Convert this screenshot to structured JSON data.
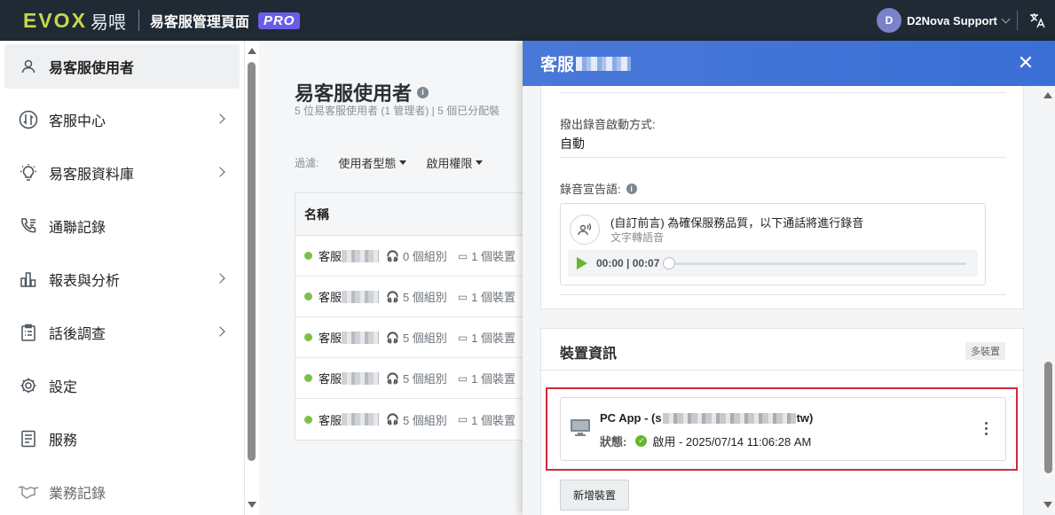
{
  "topbar": {
    "logo_text": "EVOX",
    "logo_cn": "易喂",
    "app_title": "易客服管理頁面",
    "pro_badge": "PRO",
    "user_initial": "D",
    "user_name": "D2Nova Support",
    "lang_icon": "translate-icon"
  },
  "sidebar": {
    "items": [
      {
        "label": "易客服使用者",
        "icon": "user-icon",
        "active": true
      },
      {
        "label": "客服中心",
        "icon": "phone-swap-icon"
      },
      {
        "label": "易客服資料庫",
        "icon": "bulb-icon"
      },
      {
        "label": "通聯記錄",
        "icon": "call-log-icon"
      },
      {
        "label": "報表與分析",
        "icon": "bar-chart-icon"
      },
      {
        "label": "話後調查",
        "icon": "clipboard-icon"
      },
      {
        "label": "設定",
        "icon": "gear-icon"
      },
      {
        "label": "服務",
        "icon": "document-icon"
      },
      {
        "label": "業務記錄",
        "icon": "handshake-icon"
      }
    ]
  },
  "main": {
    "title": "易客服使用者",
    "subtitle": "5 位易客服使用者 (1 管理者) | 5 個已分配裝",
    "filter_label": "過濾:",
    "filter_user_type": "使用者型態",
    "filter_permission": "啟用權限",
    "table": {
      "header_name": "名稱",
      "rows": [
        {
          "name": "客服",
          "groups": "0 個組別",
          "devices": "1 個裝置"
        },
        {
          "name": "客服",
          "groups": "5 個組別",
          "devices": "1 個裝置"
        },
        {
          "name": "客服",
          "groups": "5 個組別",
          "devices": "1 個裝置"
        },
        {
          "name": "客服",
          "groups": "5 個組別",
          "devices": "1 個裝置"
        },
        {
          "name": "客服",
          "groups": "5 個組別",
          "devices": "1 個裝置"
        }
      ]
    }
  },
  "drawer": {
    "title": "客服",
    "recording": {
      "start_label": "撥出錄音啟動方式:",
      "start_value": "自動",
      "announce_label": "錄音宣告語:",
      "audio_title": "(自訂前言) 為確保服務品質，以下通話將進行錄音",
      "audio_subtitle": "文字轉語音",
      "audio_time": "00:00 | 00:07"
    },
    "devices": {
      "section_title": "裝置資訊",
      "badge": "多裝置",
      "device_name_prefix": "PC App - (s",
      "device_name_suffix": "tw)",
      "status_label": "狀態:",
      "status_value": "啟用 - 2025/07/14 11:06:28 AM",
      "add_button": "新增裝置"
    }
  },
  "colors": {
    "topbar_bg": "#1f2a34",
    "logo_accent": "#c8d64a",
    "pro_badge": "#6b5ce7",
    "drawer_header": "#4878d8",
    "status_green": "#66b82e",
    "highlight_red": "#d1293b"
  }
}
